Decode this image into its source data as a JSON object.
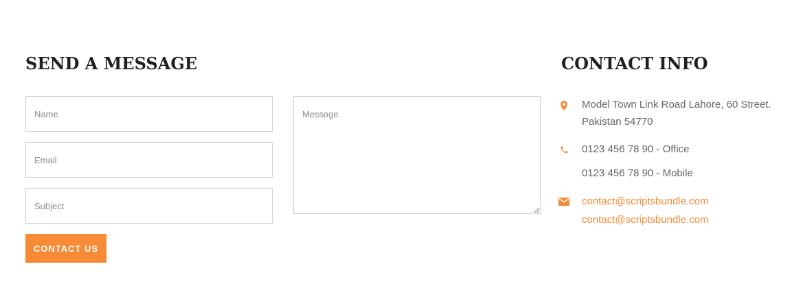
{
  "form": {
    "heading": "SEND A MESSAGE",
    "name_placeholder": "Name",
    "email_placeholder": "Email",
    "subject_placeholder": "Subject",
    "message_placeholder": "Message",
    "submit_label": "CONTACT US"
  },
  "contact_info": {
    "heading": "CONTACT INFO",
    "address_line1": "Model Town Link Road Lahore, 60 Street.",
    "address_line2": "Pakistan 54770",
    "phone_office": "0123 456 78 90 - Office",
    "phone_mobile": "0123 456 78 90 - Mobile",
    "email_1": "contact@scriptsbundle.com",
    "email_2": "contact@scriptsbundle.com",
    "icons": [
      "map-pin-icon",
      "phone-icon",
      "envelope-icon"
    ]
  },
  "colors": {
    "accent": "#f68a35",
    "heading": "#1f1f1f",
    "body_text": "#666666",
    "field_border": "#cfcfcf"
  }
}
